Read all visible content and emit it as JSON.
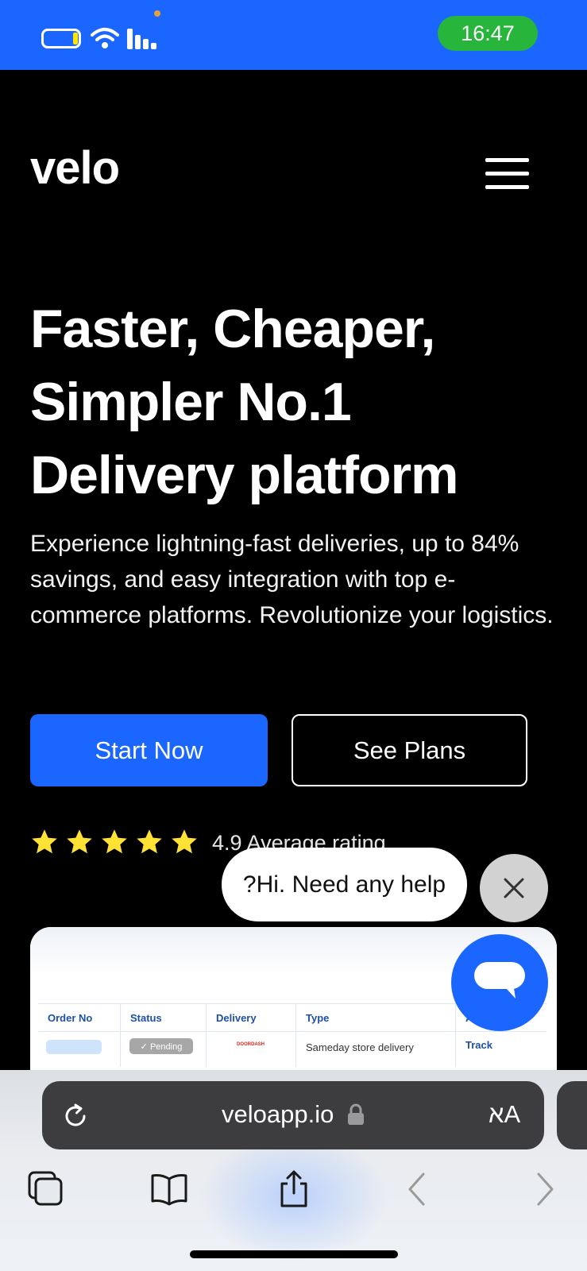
{
  "status_bar": {
    "time": "16:47",
    "colors": {
      "background": "#1a66ff",
      "time_pill": "#27b53b",
      "battery_fill": "#ffe600"
    },
    "icons": [
      "battery-icon",
      "wifi-icon",
      "cellular-signal-icon"
    ]
  },
  "header": {
    "logo": "velo",
    "menu_icon": "hamburger-menu-icon"
  },
  "hero": {
    "title_lines": [
      "Faster, Cheaper,",
      "Simpler No.1",
      "Delivery platform"
    ],
    "description": "Experience lightning-fast deliveries, up to 84% savings, and easy integration with top e-commerce platforms. Revolutionize your logistics.",
    "primary_button": "Start Now",
    "secondary_button": "See Plans",
    "rating": {
      "stars": 5,
      "text": "4.9 Average rating"
    }
  },
  "chat": {
    "bubble_text": "?Hi. Need any help",
    "close_icon": "close-icon",
    "fab_icon": "chat-bubble-icon"
  },
  "preview": {
    "columns": [
      "Order No",
      "Status",
      "Delivery",
      "Type",
      "Ac"
    ],
    "row": {
      "status": "✓ Pending",
      "delivery": "DOORDASH",
      "type": "Sameday store delivery",
      "action": "Track"
    }
  },
  "safari": {
    "url": "veloapp.io",
    "text_size_label": "אA",
    "toolbar_icons": [
      "tabs-icon",
      "bookmarks-icon",
      "share-icon",
      "back-icon",
      "forward-icon"
    ]
  },
  "colors": {
    "accent": "#1a66ff",
    "background": "#000000",
    "star": "#ffe234"
  }
}
